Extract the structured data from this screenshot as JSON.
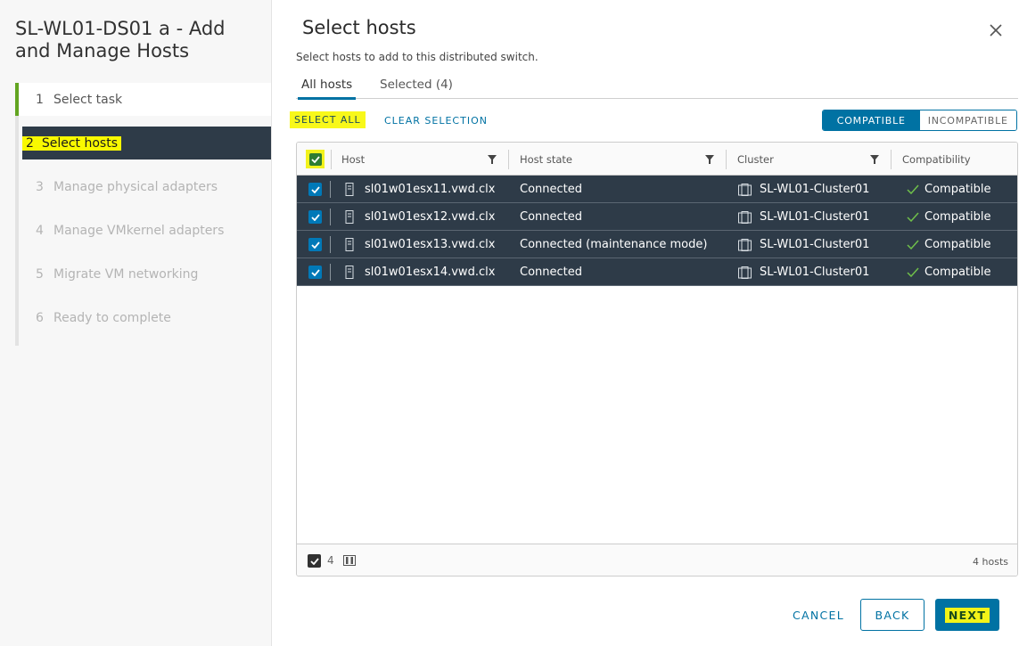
{
  "wizard": {
    "title": "SL-WL01-DS01 a - Add and Manage Hosts",
    "steps": [
      {
        "num": "1",
        "label": "Select task",
        "state": "done"
      },
      {
        "num": "2",
        "label": "Select hosts",
        "state": "active"
      },
      {
        "num": "3",
        "label": "Manage physical adapters",
        "state": "pending"
      },
      {
        "num": "4",
        "label": "Manage VMkernel adapters",
        "state": "pending"
      },
      {
        "num": "5",
        "label": "Migrate VM networking",
        "state": "pending"
      },
      {
        "num": "6",
        "label": "Ready to complete",
        "state": "pending"
      }
    ]
  },
  "page": {
    "title": "Select hosts",
    "subtitle": "Select hosts to add to this distributed switch."
  },
  "tabs": [
    {
      "label": "All hosts",
      "active": true
    },
    {
      "label": "Selected (4)",
      "active": false
    }
  ],
  "actions": {
    "select_all": "SELECT ALL",
    "clear_selection": "CLEAR SELECTION"
  },
  "filter_toggle": {
    "compatible": "COMPATIBLE",
    "incompatible": "INCOMPATIBLE",
    "selected": "compatible"
  },
  "grid": {
    "columns": [
      "Host",
      "Host state",
      "Cluster",
      "Compatibility"
    ],
    "rows": [
      {
        "host": "sl01w01esx11.vwd.clx",
        "state": "Connected",
        "cluster": "SL-WL01-Cluster01",
        "compatibility": "Compatible",
        "checked": true
      },
      {
        "host": "sl01w01esx12.vwd.clx",
        "state": "Connected",
        "cluster": "SL-WL01-Cluster01",
        "compatibility": "Compatible",
        "checked": true
      },
      {
        "host": "sl01w01esx13.vwd.clx",
        "state": "Connected (maintenance mode)",
        "cluster": "SL-WL01-Cluster01",
        "compatibility": "Compatible",
        "checked": true
      },
      {
        "host": "sl01w01esx14.vwd.clx",
        "state": "Connected",
        "cluster": "SL-WL01-Cluster01",
        "compatibility": "Compatible",
        "checked": true
      }
    ],
    "footer": {
      "selected_count": "4",
      "total": "4 hosts"
    }
  },
  "buttons": {
    "cancel": "CANCEL",
    "back": "BACK",
    "next": "NEXT"
  },
  "colors": {
    "accent": "#0072a3",
    "row_selected": "#2e3b48",
    "highlight": "#f3f318",
    "step_done": "#62a420",
    "compatible_check": "#6fbf4a"
  },
  "icons": {
    "close": "close-icon",
    "filter": "filter-icon",
    "host": "server-icon",
    "cluster": "cluster-icon",
    "compatible": "check-icon",
    "column_toggle": "columns-icon"
  }
}
